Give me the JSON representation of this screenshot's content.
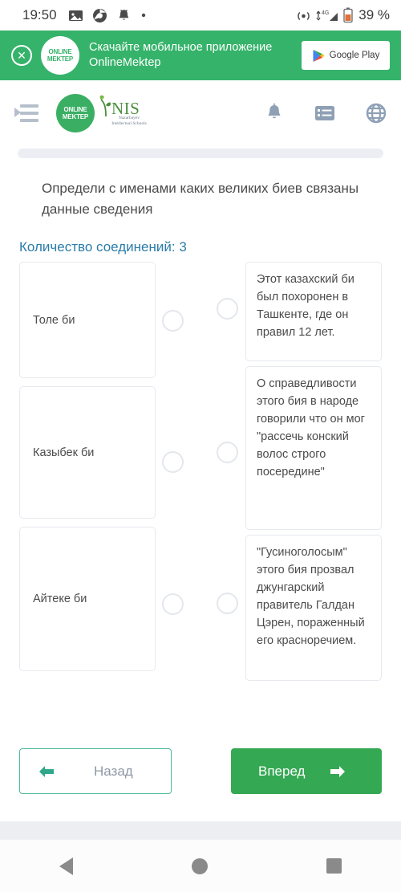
{
  "status_bar": {
    "time": "19:50",
    "battery_percent": "39 %",
    "icons": [
      "image-icon",
      "chrome-icon",
      "bell-icon",
      "dot-icon",
      "hotspot-icon",
      "signal-4g-icon",
      "battery-icon"
    ],
    "network_label": "4G"
  },
  "promo_banner": {
    "close_label": "✕",
    "logo_line1": "ONLINE",
    "logo_line2": "MEKTEP",
    "text": "Скачайте мобильное приложение OnlineMektep",
    "store_button_label": "Google Play",
    "background_color": "#35b36a"
  },
  "app_header": {
    "menu_icon": "menu-collapse-icon",
    "logo_om_line1": "ONLINE",
    "logo_om_line2": "MEKTEP",
    "logo_nis_main": "NIS",
    "logo_nis_sub": "Nazarbayev Intellectual Schools",
    "icons": [
      "bell-icon",
      "list-icon",
      "globe-icon"
    ],
    "icon_color": "#8fa0b5"
  },
  "task": {
    "question": "Определи с именами каких великих биев связаны данные сведения",
    "connections_label": "Количество соединений: 3",
    "connections_count": 3,
    "accent_color": "#2a7ca8"
  },
  "matching": {
    "left_items": [
      {
        "label": "Толе би"
      },
      {
        "label": "Казыбек би"
      },
      {
        "label": "Айтеке би"
      }
    ],
    "right_items": [
      {
        "label": "Этот казахский би был похоронен в Ташкенте, где он правил 12 лет."
      },
      {
        "label": "О справедливости этого бия в народе говорили что он мог \"рассечь конский волос строго посередине\""
      },
      {
        "label": "\"Гусиноголосым\" этого бия прозвал джунгарский правитель Галдан Цэрен, пораженный его красноречием."
      }
    ]
  },
  "footer": {
    "back_label": "Назад",
    "forward_label": "Вперед",
    "back_arrow": "←",
    "forward_arrow": "→",
    "forward_color": "#35a853",
    "back_border_color": "#4cb99b"
  },
  "navigation_bar": {
    "back": "nav-back-icon",
    "home": "nav-home-icon",
    "recents": "nav-recents-icon"
  }
}
